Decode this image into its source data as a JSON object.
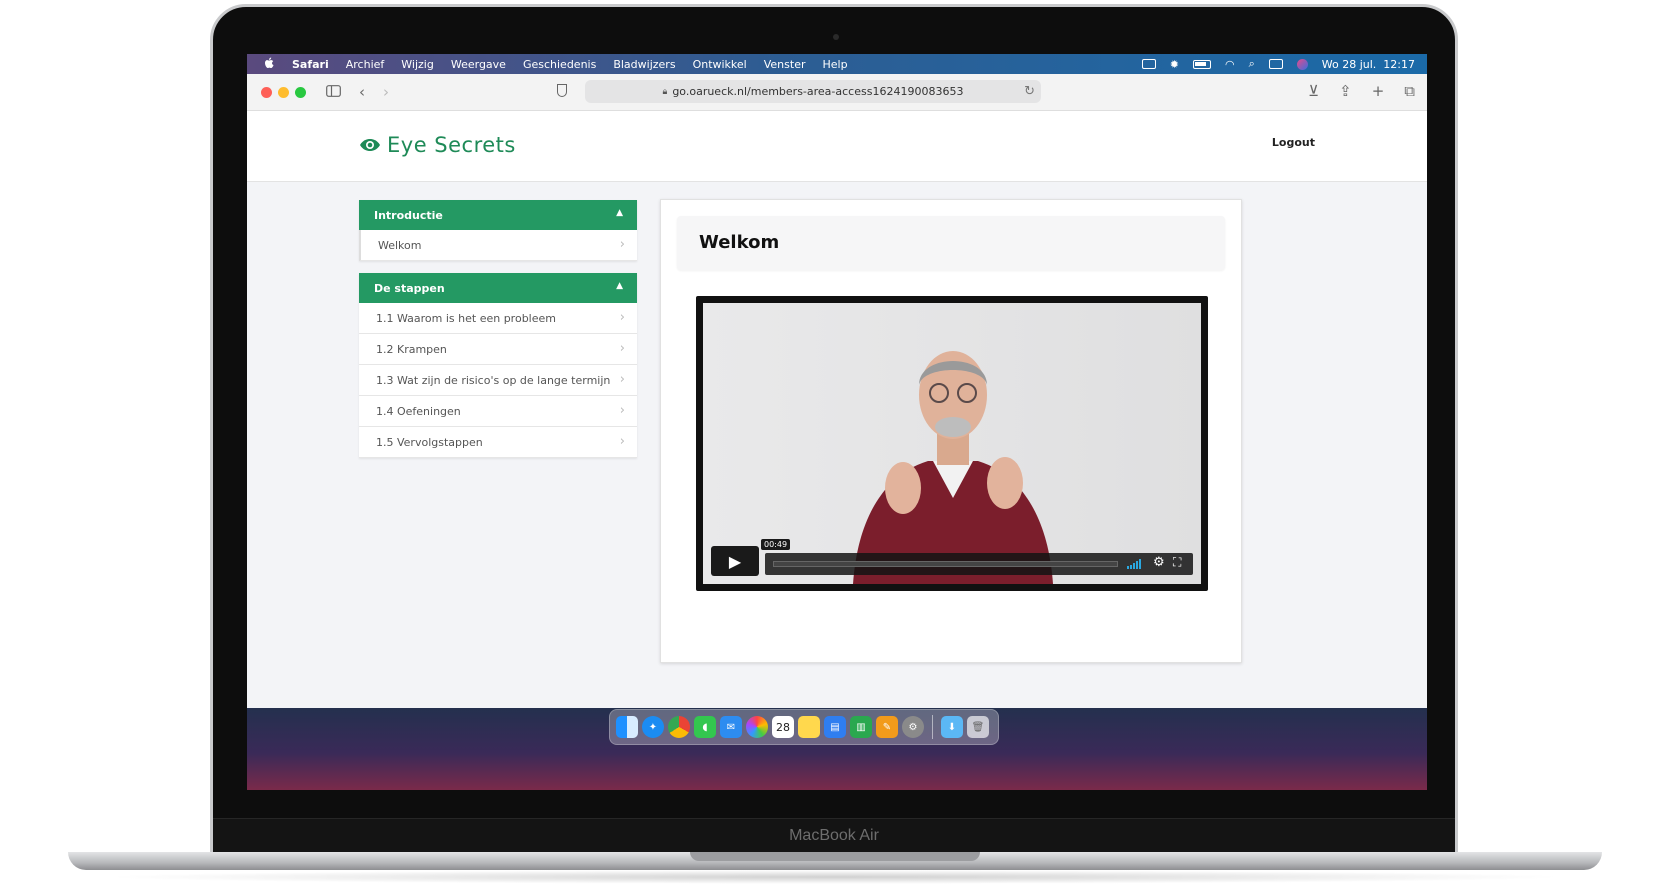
{
  "device": {
    "model_label": "MacBook Air"
  },
  "menubar": {
    "apple_icon": "apple-logo-icon",
    "items": [
      "Safari",
      "Archief",
      "Wijzig",
      "Weergave",
      "Geschiedenis",
      "Bladwijzers",
      "Ontwikkel",
      "Venster",
      "Help"
    ],
    "clock": "Wo 28 jul.  12:17"
  },
  "browser": {
    "url": "go.oarueck.nl/members-area-access1624190083653"
  },
  "site": {
    "logo_text": "Eye Secrets",
    "logout_label": "Logout",
    "brand_color": "#249963"
  },
  "sidebar": {
    "groups": [
      {
        "title": "Introductie",
        "items": [
          "Welkom"
        ]
      },
      {
        "title": "De stappen",
        "items": [
          "1.1 Waarom is het een probleem",
          "1.2 Krampen",
          "1.3 Wat zijn de risico's op de lange termijn",
          "1.4 Oefeningen",
          "1.5 Vervolgstappen"
        ]
      }
    ]
  },
  "lesson": {
    "title": "Welkom",
    "video": {
      "timecode": "00:49"
    }
  },
  "dock": {
    "calendar_day": "28",
    "apps": [
      "finder-icon",
      "safari-icon",
      "chrome-icon",
      "messages-icon",
      "mail-icon",
      "photos-icon",
      "calendar-icon",
      "notes-icon",
      "keynote-icon",
      "numbers-icon",
      "pages-icon",
      "system-preferences-icon",
      "downloads-folder-icon",
      "trash-icon"
    ]
  }
}
